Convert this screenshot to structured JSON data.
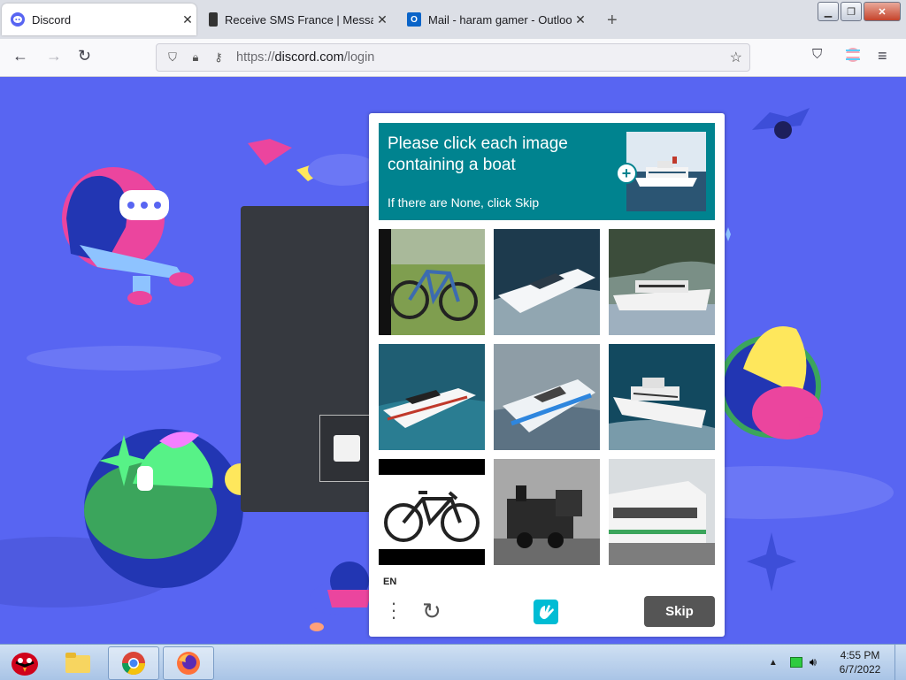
{
  "tabs": [
    {
      "title": "Discord",
      "active": true
    },
    {
      "title": "Receive SMS France | Messages",
      "active": false
    },
    {
      "title": "Mail - haram gamer - Outlook",
      "active": false
    }
  ],
  "navbar": {
    "url_prefix": "https://",
    "url_host": "discord.com",
    "url_path": "/login"
  },
  "captcha": {
    "title": "Please click each image containing a boat",
    "subtitle": "If there are None, click Skip",
    "language": "EN",
    "skip_label": "Skip",
    "tiles": [
      "bicycle",
      "speedboat",
      "yacht",
      "speedboat",
      "speedboat",
      "yacht",
      "bicycle",
      "steam train",
      "train"
    ]
  },
  "taskbar": {
    "time": "4:55 PM",
    "date": "6/7/2022"
  },
  "colors": {
    "brand": "#5865f2",
    "captcha_accent": "#00838f"
  }
}
